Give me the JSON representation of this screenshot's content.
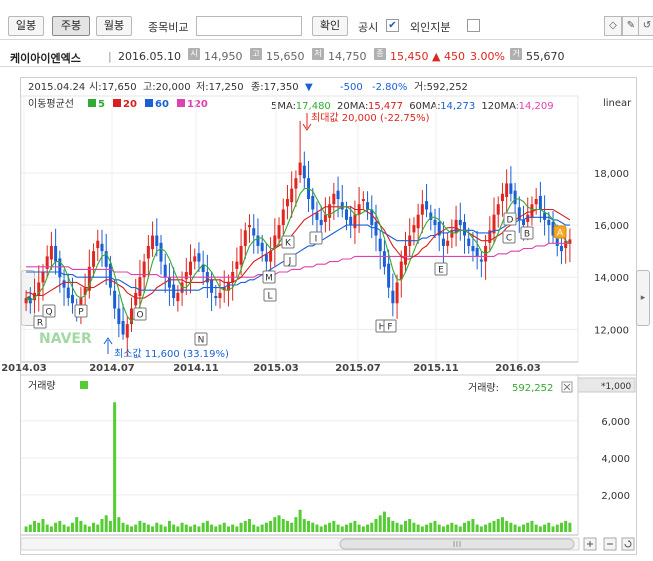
{
  "toolbar": {
    "daily": "일봉",
    "weekly": "주봉",
    "monthly": "월봉",
    "compare_label": "종목비교",
    "compare_placeholder": "",
    "confirm": "확인",
    "disclosure": "공시",
    "foreign": "외인지분",
    "disclosure_checked": "✔",
    "icons": [
      "bulb-icon",
      "pencil-icon",
      "reset-icon"
    ]
  },
  "info": {
    "name": "케이아이엔엑스",
    "date": "2016.05.10",
    "open_badge": "시",
    "open": "14,950",
    "high_badge": "고",
    "high": "15,650",
    "low_badge": "저",
    "low": "14,750",
    "close_badge": "종",
    "close": "15,450",
    "change": "▲ 450",
    "change_pct": "3.00%",
    "volume_badge": "거",
    "volume": "55,670",
    "colors": {
      "up": "#e0261f",
      "down": "#1a5fd6"
    }
  },
  "chart_data": {
    "type": "candlestick",
    "header": {
      "date": "2015.04.24",
      "open": "시:17,650",
      "high": "고:20,000",
      "low": "저:17,250",
      "close": "종:17,350",
      "arrow": "▼",
      "change": "-500",
      "change_pct": "-2.80%",
      "volume": "거:592,252"
    },
    "legend": {
      "title": "이동평균선",
      "items": [
        {
          "label": "5",
          "color": "#33aa33"
        },
        {
          "label": "20",
          "color": "#d62020"
        },
        {
          "label": "60",
          "color": "#1a5fd6"
        },
        {
          "label": "120",
          "color": "#e040b0"
        }
      ]
    },
    "ma_readout": [
      {
        "label": "5MA:",
        "value": "17,480",
        "color": "#33aa33"
      },
      {
        "label": "20MA:",
        "value": "15,477",
        "color": "#d62020"
      },
      {
        "label": "60MA:",
        "value": "14,273",
        "color": "#1a5fd6"
      },
      {
        "label": "120MA:",
        "value": "14,209",
        "color": "#e040b0"
      }
    ],
    "scale_label": "linear",
    "y_ticks": [
      "18,000",
      "16,000",
      "14,000",
      "12,000"
    ],
    "y_tick_values": [
      18000,
      16000,
      14000,
      12000
    ],
    "ylim": [
      10900,
      20800
    ],
    "x_ticks": [
      "2014.03",
      "2014.07",
      "2014.11",
      "2015.03",
      "2015.07",
      "2015.11",
      "2016.03"
    ],
    "max_label": "최대값 20,000 (-22.75%)",
    "min_label": "최소값 11,600 (33.19%)",
    "max_value": 20000,
    "min_value": 11600,
    "watermark": "NAVER",
    "markers": [
      "R",
      "Q",
      "P",
      "O",
      "N",
      "L",
      "M",
      "J",
      "K",
      "I",
      "H",
      "F",
      "E",
      "D",
      "C",
      "B",
      "A"
    ],
    "close_series": [
      13200,
      13000,
      13400,
      13800,
      14200,
      14800,
      15200,
      14600,
      14000,
      13600,
      13200,
      13000,
      12800,
      13200,
      13600,
      14400,
      15000,
      15400,
      15000,
      14400,
      13600,
      12800,
      12200,
      11800,
      12200,
      12800,
      13400,
      14000,
      14600,
      15200,
      15600,
      15200,
      14600,
      14000,
      13600,
      13200,
      13400,
      13800,
      14200,
      14600,
      14800,
      14600,
      14200,
      13800,
      13400,
      13200,
      13400,
      13600,
      13800,
      14200,
      14600,
      15200,
      15800,
      16000,
      15600,
      15200,
      15000,
      14600,
      15000,
      15600,
      16000,
      16600,
      17000,
      17400,
      17800,
      18400,
      17800,
      17000,
      16600,
      16200,
      16000,
      16400,
      16800,
      17200,
      17000,
      16600,
      16200,
      16000,
      16400,
      16800,
      17000,
      16600,
      16000,
      15600,
      15000,
      14400,
      13600,
      13000,
      13800,
      14600,
      15200,
      15600,
      16000,
      16400,
      16800,
      16600,
      16200,
      16000,
      15600,
      15200,
      15400,
      15800,
      16200,
      16000,
      15600,
      15200,
      15000,
      14800,
      14600,
      15200,
      15800,
      16400,
      16800,
      17200,
      17600,
      17200,
      16800,
      16200,
      16000,
      16400,
      16800,
      17000,
      16600,
      16200,
      16000,
      15600,
      15200,
      15000,
      15400,
      15450
    ],
    "ma5": [
      13200,
      13100,
      13200,
      13400,
      13600,
      14000,
      14400,
      14600,
      14600,
      14400,
      14000,
      13600,
      13300,
      13200,
      13300,
      13700,
      14100,
      14500,
      14800,
      14900,
      14600,
      14100,
      13500,
      12900,
      12500,
      12300,
      12500,
      12900,
      13400,
      14000,
      14600,
      15000,
      15100,
      15000,
      14700,
      14300,
      13900,
      13600,
      13600,
      13800,
      14100,
      14300,
      14500,
      14400,
      14200,
      13900,
      13600,
      13500,
      13500,
      13600,
      13900,
      14300,
      14800,
      15200,
      15400,
      15500,
      15500,
      15300,
      15100,
      15100,
      15300,
      15600,
      16000,
      16400,
      16800,
      17200,
      17400,
      17400,
      17300,
      17000,
      16700,
      16400,
      16400,
      16500,
      16600,
      16700,
      16700,
      16600,
      16400,
      16400,
      16500,
      16600,
      16600,
      16400,
      16000,
      15500,
      14900,
      14300,
      13900,
      13900,
      14200,
      14600,
      15000,
      15400,
      15800,
      16100,
      16300,
      16300,
      16200,
      16000,
      15800,
      15700,
      15700,
      15800,
      15800,
      15700,
      15500,
      15300,
      15000,
      14900,
      15000,
      15300,
      15700,
      16100,
      16500,
      16800,
      17000,
      17000,
      16900,
      16700,
      16600,
      16600,
      16600,
      16500,
      16400,
      16200,
      15900,
      15600,
      15400,
      15300
    ],
    "ma20": [
      13400,
      13400,
      13300,
      13300,
      13300,
      13400,
      13500,
      13600,
      13700,
      13800,
      13800,
      13800,
      13800,
      13700,
      13600,
      13600,
      13600,
      13700,
      13800,
      13900,
      13900,
      13800,
      13700,
      13600,
      13400,
      13300,
      13200,
      13200,
      13200,
      13300,
      13400,
      13600,
      13700,
      13800,
      13900,
      13900,
      13900,
      13900,
      13800,
      13800,
      13800,
      13800,
      13800,
      13900,
      13900,
      13900,
      13900,
      13800,
      13800,
      13800,
      13900,
      14000,
      14200,
      14400,
      14600,
      14700,
      14800,
      14900,
      15000,
      15100,
      15200,
      15300,
      15400,
      15600,
      15800,
      16000,
      16200,
      16300,
      16400,
      16500,
      16600,
      16700,
      16700,
      16700,
      16700,
      16700,
      16700,
      16700,
      16600,
      16600,
      16600,
      16500,
      16400,
      16200,
      16000,
      15800,
      15500,
      15200,
      15000,
      14800,
      14700,
      14700,
      14800,
      14900,
      15100,
      15200,
      15400,
      15600,
      15700,
      15800,
      15900,
      15900,
      15900,
      15800,
      15800,
      15700,
      15600,
      15500,
      15400,
      15400,
      15400,
      15500,
      15600,
      15700,
      15900,
      16000,
      16200,
      16300,
      16400,
      16500,
      16500,
      16600,
      16600,
      16600,
      16600,
      16600,
      16500,
      16400,
      16300,
      16200
    ],
    "ma60": [
      14200,
      14200,
      14200,
      14200,
      14200,
      14200,
      14200,
      14200,
      14200,
      14100,
      14100,
      14100,
      14000,
      14000,
      14000,
      14000,
      14000,
      14000,
      14000,
      14000,
      14000,
      13900,
      13900,
      13800,
      13700,
      13600,
      13600,
      13500,
      13500,
      13500,
      13500,
      13500,
      13500,
      13500,
      13500,
      13500,
      13500,
      13500,
      13500,
      13500,
      13500,
      13500,
      13600,
      13600,
      13600,
      13600,
      13600,
      13600,
      13700,
      13700,
      13700,
      13800,
      13800,
      13900,
      13900,
      14000,
      14100,
      14200,
      14300,
      14400,
      14500,
      14600,
      14700,
      14800,
      14900,
      15000,
      15100,
      15200,
      15200,
      15300,
      15400,
      15500,
      15600,
      15700,
      15800,
      15900,
      16000,
      16000,
      16000,
      16000,
      16000,
      16000,
      15900,
      15900,
      15800,
      15700,
      15600,
      15500,
      15400,
      15400,
      15400,
      15400,
      15400,
      15400,
      15500,
      15500,
      15600,
      15600,
      15700,
      15700,
      15700,
      15800,
      15800,
      15800,
      15800,
      15800,
      15800,
      15700,
      15700,
      15700,
      15700,
      15800,
      15800,
      15900,
      16000,
      16100,
      16100,
      16200,
      16200,
      16300,
      16300,
      16300,
      16300,
      16300,
      16300,
      16200,
      16200,
      16100,
      16000,
      16000
    ],
    "ma120": [
      14400,
      14400,
      14400,
      14400,
      14400,
      14400,
      14400,
      14400,
      14400,
      14400,
      14400,
      14300,
      14300,
      14300,
      14300,
      14300,
      14300,
      14300,
      14300,
      14300,
      14300,
      14200,
      14200,
      14200,
      14200,
      14100,
      14100,
      14100,
      14100,
      14100,
      14100,
      14100,
      14000,
      14000,
      14000,
      14000,
      14000,
      14000,
      14000,
      14000,
      14000,
      14000,
      14000,
      14000,
      14000,
      14000,
      14000,
      14000,
      14000,
      14000,
      14000,
      14000,
      14000,
      14000,
      14000,
      14100,
      14100,
      14100,
      14100,
      14100,
      14200,
      14200,
      14200,
      14300,
      14300,
      14300,
      14400,
      14400,
      14400,
      14500,
      14500,
      14500,
      14600,
      14600,
      14600,
      14700,
      14700,
      14700,
      14800,
      14800,
      14800,
      14800,
      14800,
      14800,
      14800,
      14800,
      14800,
      14800,
      14800,
      14800,
      14800,
      14800,
      14800,
      14800,
      14800,
      14800,
      14800,
      14800,
      14800,
      14800,
      14800,
      14800,
      14800,
      14800,
      14800,
      14800,
      14800,
      14800,
      14800,
      14800,
      14800,
      14800,
      14900,
      14900,
      14900,
      15000,
      15000,
      15000,
      15100,
      15100,
      15100,
      15200,
      15200,
      15200,
      15300,
      15300,
      15300,
      15300,
      15300,
      15300
    ],
    "volume": {
      "title": "거래량",
      "readout_label": "거래량:",
      "readout_value": "592,252",
      "readout_color": "#33aa33",
      "unit": "*1,000",
      "y_ticks": [
        "6,000",
        "4,000",
        "2,000"
      ],
      "y_tick_values": [
        6000,
        4000,
        2000
      ],
      "ylim": [
        0,
        7500
      ],
      "values": [
        300,
        400,
        600,
        500,
        700,
        400,
        300,
        500,
        600,
        400,
        300,
        500,
        800,
        600,
        400,
        300,
        500,
        400,
        700,
        900,
        600,
        7000,
        800,
        500,
        400,
        300,
        400,
        600,
        500,
        400,
        300,
        500,
        400,
        300,
        600,
        400,
        300,
        500,
        400,
        300,
        400,
        300,
        500,
        600,
        400,
        300,
        400,
        500,
        300,
        400,
        300,
        500,
        600,
        700,
        400,
        300,
        400,
        500,
        600,
        800,
        900,
        700,
        600,
        500,
        800,
        1200,
        700,
        600,
        500,
        400,
        300,
        400,
        500,
        600,
        400,
        300,
        400,
        500,
        600,
        400,
        300,
        400,
        500,
        700,
        900,
        1100,
        800,
        600,
        500,
        400,
        600,
        700,
        500,
        400,
        300,
        400,
        500,
        600,
        400,
        300,
        400,
        500,
        400,
        300,
        500,
        600,
        700,
        400,
        300,
        400,
        500,
        600,
        700,
        800,
        600,
        500,
        400,
        300,
        400,
        500,
        600,
        400,
        300,
        400,
        500,
        300,
        400,
        500,
        600,
        500
      ]
    }
  }
}
